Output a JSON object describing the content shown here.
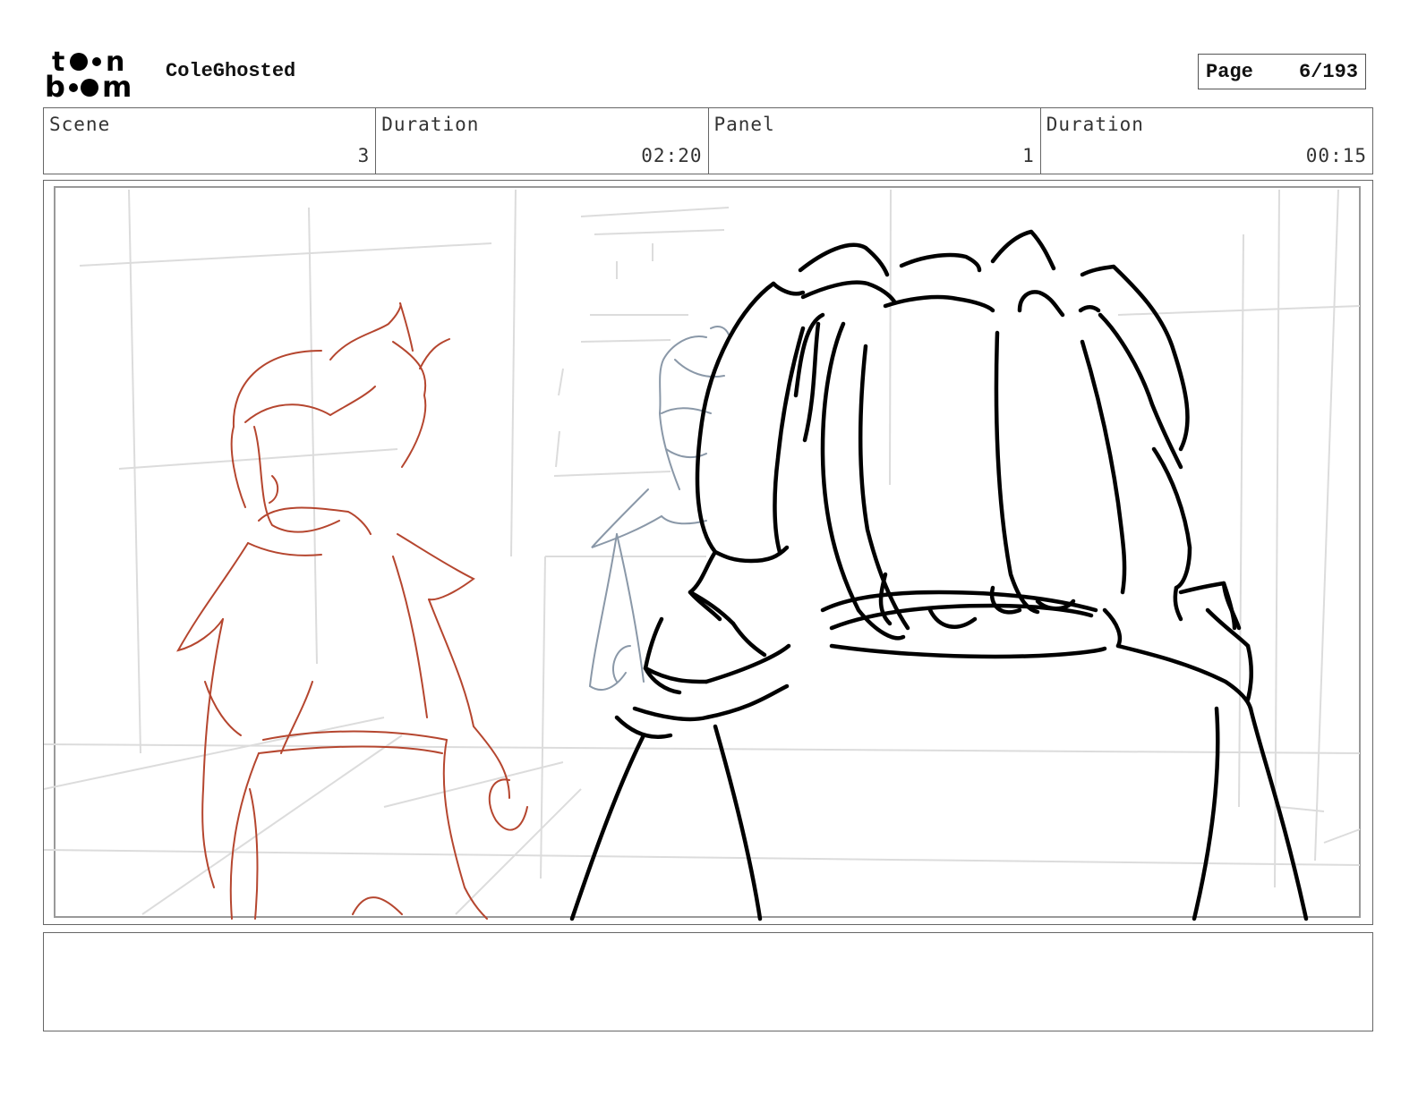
{
  "header": {
    "logo_text": "toon boom",
    "project_title": "ColeGhosted",
    "page_label": "Page",
    "page_value": "6/193"
  },
  "info": {
    "scene_label": "Scene",
    "scene_value": "3",
    "scene_duration_label": "Duration",
    "scene_duration_value": "02:20",
    "panel_label": "Panel",
    "panel_value": "1",
    "panel_duration_label": "Duration",
    "panel_duration_value": "00:15"
  },
  "panel": {
    "notes_text": ""
  },
  "colors": {
    "rough_red": "#b5462f",
    "rough_blue": "#8a98a8",
    "ink": "#000000",
    "guide": "#dddddd",
    "border": "#666666"
  }
}
